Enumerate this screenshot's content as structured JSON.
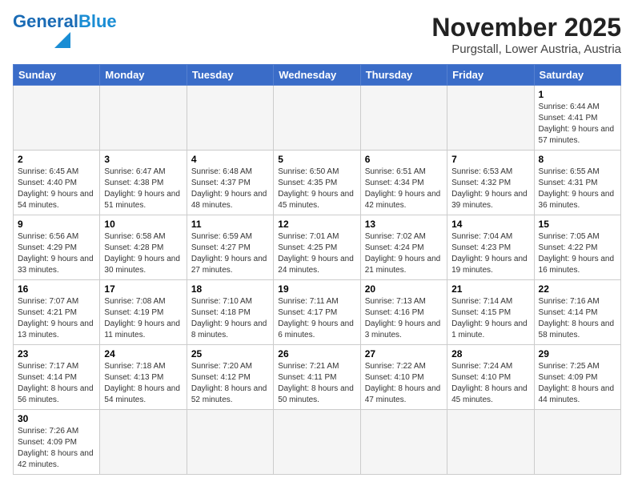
{
  "header": {
    "logo_text_general": "General",
    "logo_text_blue": "Blue",
    "month_year": "November 2025",
    "location": "Purgstall, Lower Austria, Austria"
  },
  "weekdays": [
    "Sunday",
    "Monday",
    "Tuesday",
    "Wednesday",
    "Thursday",
    "Friday",
    "Saturday"
  ],
  "weeks": [
    [
      {
        "day": "",
        "info": ""
      },
      {
        "day": "",
        "info": ""
      },
      {
        "day": "",
        "info": ""
      },
      {
        "day": "",
        "info": ""
      },
      {
        "day": "",
        "info": ""
      },
      {
        "day": "",
        "info": ""
      },
      {
        "day": "1",
        "info": "Sunrise: 6:44 AM\nSunset: 4:41 PM\nDaylight: 9 hours and 57 minutes."
      }
    ],
    [
      {
        "day": "2",
        "info": "Sunrise: 6:45 AM\nSunset: 4:40 PM\nDaylight: 9 hours and 54 minutes."
      },
      {
        "day": "3",
        "info": "Sunrise: 6:47 AM\nSunset: 4:38 PM\nDaylight: 9 hours and 51 minutes."
      },
      {
        "day": "4",
        "info": "Sunrise: 6:48 AM\nSunset: 4:37 PM\nDaylight: 9 hours and 48 minutes."
      },
      {
        "day": "5",
        "info": "Sunrise: 6:50 AM\nSunset: 4:35 PM\nDaylight: 9 hours and 45 minutes."
      },
      {
        "day": "6",
        "info": "Sunrise: 6:51 AM\nSunset: 4:34 PM\nDaylight: 9 hours and 42 minutes."
      },
      {
        "day": "7",
        "info": "Sunrise: 6:53 AM\nSunset: 4:32 PM\nDaylight: 9 hours and 39 minutes."
      },
      {
        "day": "8",
        "info": "Sunrise: 6:55 AM\nSunset: 4:31 PM\nDaylight: 9 hours and 36 minutes."
      }
    ],
    [
      {
        "day": "9",
        "info": "Sunrise: 6:56 AM\nSunset: 4:29 PM\nDaylight: 9 hours and 33 minutes."
      },
      {
        "day": "10",
        "info": "Sunrise: 6:58 AM\nSunset: 4:28 PM\nDaylight: 9 hours and 30 minutes."
      },
      {
        "day": "11",
        "info": "Sunrise: 6:59 AM\nSunset: 4:27 PM\nDaylight: 9 hours and 27 minutes."
      },
      {
        "day": "12",
        "info": "Sunrise: 7:01 AM\nSunset: 4:25 PM\nDaylight: 9 hours and 24 minutes."
      },
      {
        "day": "13",
        "info": "Sunrise: 7:02 AM\nSunset: 4:24 PM\nDaylight: 9 hours and 21 minutes."
      },
      {
        "day": "14",
        "info": "Sunrise: 7:04 AM\nSunset: 4:23 PM\nDaylight: 9 hours and 19 minutes."
      },
      {
        "day": "15",
        "info": "Sunrise: 7:05 AM\nSunset: 4:22 PM\nDaylight: 9 hours and 16 minutes."
      }
    ],
    [
      {
        "day": "16",
        "info": "Sunrise: 7:07 AM\nSunset: 4:21 PM\nDaylight: 9 hours and 13 minutes."
      },
      {
        "day": "17",
        "info": "Sunrise: 7:08 AM\nSunset: 4:19 PM\nDaylight: 9 hours and 11 minutes."
      },
      {
        "day": "18",
        "info": "Sunrise: 7:10 AM\nSunset: 4:18 PM\nDaylight: 9 hours and 8 minutes."
      },
      {
        "day": "19",
        "info": "Sunrise: 7:11 AM\nSunset: 4:17 PM\nDaylight: 9 hours and 6 minutes."
      },
      {
        "day": "20",
        "info": "Sunrise: 7:13 AM\nSunset: 4:16 PM\nDaylight: 9 hours and 3 minutes."
      },
      {
        "day": "21",
        "info": "Sunrise: 7:14 AM\nSunset: 4:15 PM\nDaylight: 9 hours and 1 minute."
      },
      {
        "day": "22",
        "info": "Sunrise: 7:16 AM\nSunset: 4:14 PM\nDaylight: 8 hours and 58 minutes."
      }
    ],
    [
      {
        "day": "23",
        "info": "Sunrise: 7:17 AM\nSunset: 4:14 PM\nDaylight: 8 hours and 56 minutes."
      },
      {
        "day": "24",
        "info": "Sunrise: 7:18 AM\nSunset: 4:13 PM\nDaylight: 8 hours and 54 minutes."
      },
      {
        "day": "25",
        "info": "Sunrise: 7:20 AM\nSunset: 4:12 PM\nDaylight: 8 hours and 52 minutes."
      },
      {
        "day": "26",
        "info": "Sunrise: 7:21 AM\nSunset: 4:11 PM\nDaylight: 8 hours and 50 minutes."
      },
      {
        "day": "27",
        "info": "Sunrise: 7:22 AM\nSunset: 4:10 PM\nDaylight: 8 hours and 47 minutes."
      },
      {
        "day": "28",
        "info": "Sunrise: 7:24 AM\nSunset: 4:10 PM\nDaylight: 8 hours and 45 minutes."
      },
      {
        "day": "29",
        "info": "Sunrise: 7:25 AM\nSunset: 4:09 PM\nDaylight: 8 hours and 44 minutes."
      }
    ],
    [
      {
        "day": "30",
        "info": "Sunrise: 7:26 AM\nSunset: 4:09 PM\nDaylight: 8 hours and 42 minutes."
      },
      {
        "day": "",
        "info": ""
      },
      {
        "day": "",
        "info": ""
      },
      {
        "day": "",
        "info": ""
      },
      {
        "day": "",
        "info": ""
      },
      {
        "day": "",
        "info": ""
      },
      {
        "day": "",
        "info": ""
      }
    ]
  ]
}
